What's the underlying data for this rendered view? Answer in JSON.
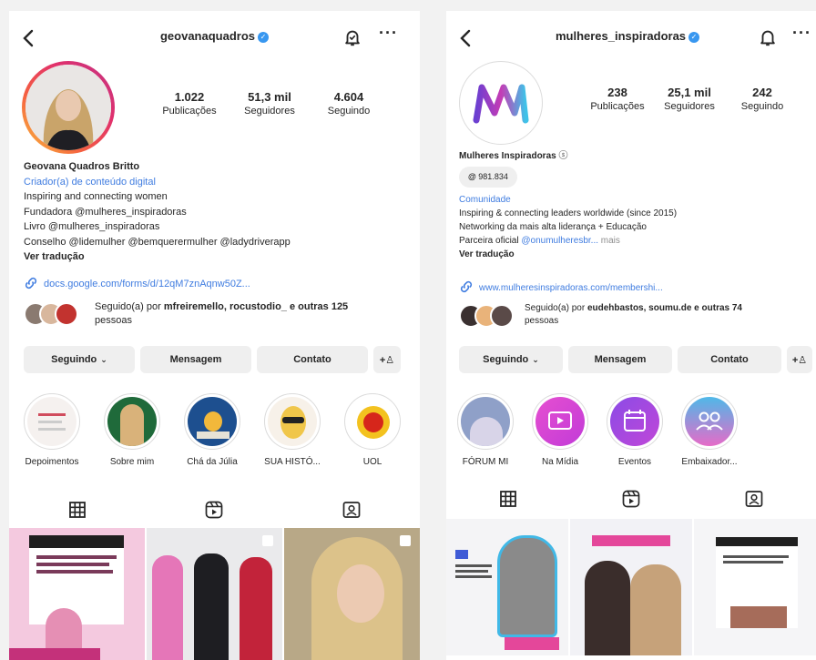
{
  "left": {
    "username": "geovanaquadros",
    "stats": [
      {
        "value": "1.022",
        "label": "Publicações"
      },
      {
        "value": "51,3 mil",
        "label": "Seguidores"
      },
      {
        "value": "4.604",
        "label": "Seguindo"
      }
    ],
    "name": "Geovana Quadros Britto",
    "category": "Criador(a) de conteúdo digital",
    "bio_lines": [
      "Inspiring and connecting women",
      "Fundadora @mulheres_inspiradoras",
      "Livro @mulheres_inspiradoras",
      "Conselho @lidemulher @bemquerermulher @ladydriverapp"
    ],
    "translate": "Ver tradução",
    "link": "docs.google.com/forms/d/12qM7znAqnw50Z...",
    "followed_by_prefix": "Seguido(a) por ",
    "followed_by_names": "mfreiremello, rocustodio_ e outras 125",
    "followed_by_suffix": "pessoas",
    "buttons": {
      "following": "Seguindo",
      "message": "Mensagem",
      "contact": "Contato"
    },
    "highlights": [
      "Depoimentos",
      "Sobre mim",
      "Chá da Júlia",
      "SUA HISTÓ...",
      "UOL"
    ]
  },
  "right": {
    "username": "mulheres_inspiradoras",
    "stats": [
      {
        "value": "238",
        "label": "Publicações"
      },
      {
        "value": "25,1 mil",
        "label": "Seguidores"
      },
      {
        "value": "242",
        "label": "Seguindo"
      }
    ],
    "name": "Mulheres Inspiradoras",
    "threads_count": "981.834",
    "category": "Comunidade",
    "bio_lines": [
      "Inspiring & connecting leaders worldwide (since 2015)",
      "Networking da mais alta liderança + Educação"
    ],
    "partner_prefix": "Parceira oficial ",
    "partner_link": "@onumulheresbr...",
    "partner_more": " mais",
    "translate": "Ver tradução",
    "link": "www.mulheresinspiradoras.com/membershi...",
    "followed_by_prefix": "Seguido(a) por ",
    "followed_by_names": "eudehbastos, soumu.de e outras 74",
    "followed_by_suffix": "pessoas",
    "buttons": {
      "following": "Seguindo",
      "message": "Mensagem",
      "contact": "Contato"
    },
    "highlights": [
      "FÓRUM MI",
      "Na Mídia",
      "Eventos",
      "Embaixador..."
    ]
  },
  "colors": {
    "link": "#3f7ce0",
    "verified": "#3897f0",
    "story_ring": "#e1306c"
  }
}
